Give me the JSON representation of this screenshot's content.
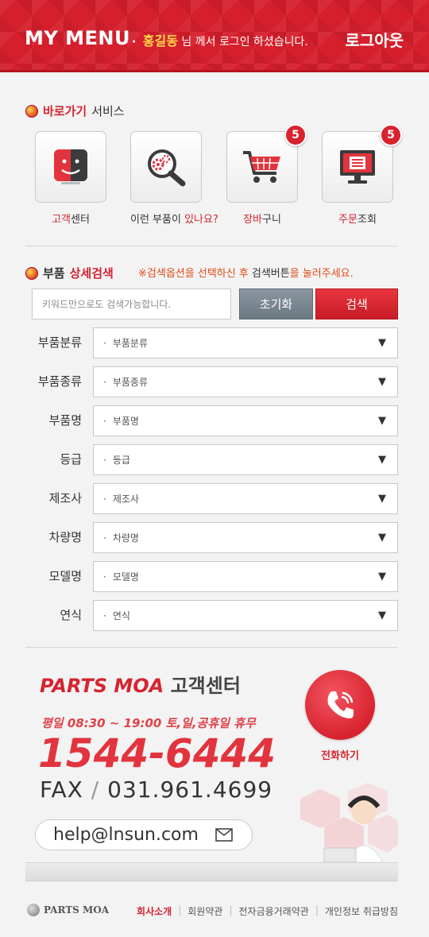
{
  "header": {
    "title": "MY MENU",
    "greeting_bullet": "·",
    "user_name": "홍길동",
    "greeting_suffix": "님 께서 로그인 하셨습니다.",
    "logout_label": "로그아웃"
  },
  "quick_service": {
    "title_red": "바로가기",
    "title_rest": "서비스",
    "items": [
      {
        "label_red": "고객",
        "label_rest": "센터",
        "icon": "customer-face-icon",
        "badge": ""
      },
      {
        "label_red": "",
        "label_rest": "이런 부품이 ",
        "label_red2": "있나요?",
        "icon": "parts-search-icon",
        "badge": ""
      },
      {
        "label_red": "장바",
        "label_rest": "구니",
        "icon": "cart-icon",
        "badge": "5"
      },
      {
        "label_red": "주문",
        "label_rest": "조회",
        "icon": "monitor-icon",
        "badge": "5"
      }
    ]
  },
  "detail_search": {
    "title_part": "부품",
    "title_red": "상세검색",
    "notice_a": "※검색옵션을 선택하신 후 ",
    "notice_b": "검색버튼",
    "notice_c": "을 눌러주세요.",
    "keyword_placeholder": "키워드만으로도 검색가능합니다.",
    "reset_label": "초기화",
    "search_label": "검색",
    "filters": [
      {
        "label": "부품분류",
        "value": "부품분류"
      },
      {
        "label": "부품종류",
        "value": "부품종류"
      },
      {
        "label": "부품명",
        "value": "부품명"
      },
      {
        "label": "등급",
        "value": "등급"
      },
      {
        "label": "제조사",
        "value": "제조사"
      },
      {
        "label": "차량명",
        "value": "차량명"
      },
      {
        "label": "모델명",
        "value": "모델명"
      },
      {
        "label": "연식",
        "value": "연식"
      }
    ],
    "bullet": "·",
    "arrow": "▼"
  },
  "customer_center": {
    "brand": "PARTS MOA",
    "title": "고객센터",
    "hours": "평일 08:30 ~ 19:00 토,일,공휴일 휴무",
    "phone": "1544-6444",
    "fax_label": "FAX",
    "fax_sep": "/",
    "fax_number": "031.961.4699",
    "email": "help@lnsun.com",
    "call_label": "전화하기"
  },
  "footer": {
    "logo_text": "PARTS MOA",
    "links": [
      "회사소개",
      "회원약관",
      "전자금융거래약관",
      "개인정보 취급방침"
    ],
    "separator": "|"
  },
  "colors": {
    "accent": "#d52430",
    "header_bg": "#d51f2c",
    "reset_btn": "#7a868f",
    "badge": "#d8232f"
  }
}
